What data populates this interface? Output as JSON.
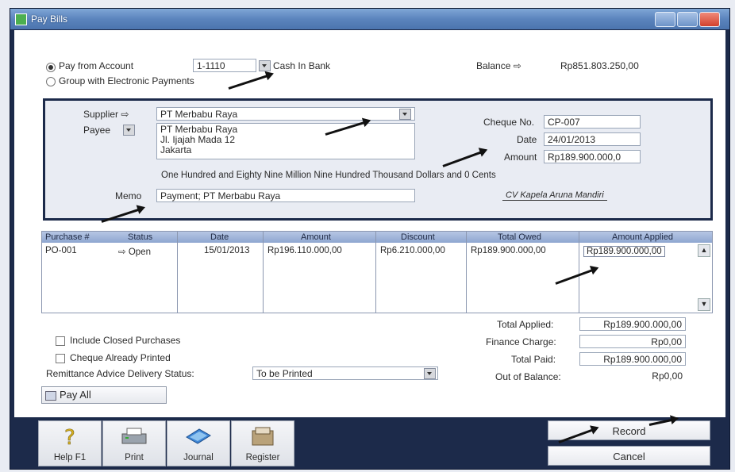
{
  "window": {
    "title": "Pay Bills"
  },
  "pay_from": {
    "label": "Pay from Account",
    "account_no": "1-1110",
    "account_name": "Cash In Bank",
    "group_label": "Group with Electronic Payments",
    "balance_label": "Balance ⇨",
    "balance_value": "Rp851.803.250,00"
  },
  "supplier": {
    "supplier_label": "Supplier ⇨",
    "supplier_value": "PT Merbabu Raya",
    "payee_label": "Payee",
    "payee_lines": [
      "PT Merbabu Raya",
      "Jl. Ijajah Mada 12",
      "Jakarta"
    ],
    "amount_words": "One Hundred and Eighty Nine Million Nine Hundred Thousand Dollars and 0 Cents",
    "memo_label": "Memo",
    "memo_value": "Payment; PT Merbabu Raya",
    "cheque_label": "Cheque No.",
    "cheque_value": "CP-007",
    "date_label": "Date",
    "date_value": "24/01/2013",
    "amount_label": "Amount",
    "amount_value": "Rp189.900.000,0",
    "signature": "CV Kapela Aruna Mandiri"
  },
  "grid": {
    "headers": [
      "Purchase #",
      "Status",
      "Date",
      "Amount",
      "Discount",
      "Total Owed",
      "Amount Applied"
    ],
    "rows": [
      {
        "purchase": "PO-001",
        "status": "⇨ Open",
        "date": "15/01/2013",
        "amount": "Rp196.110.000,00",
        "discount": "Rp6.210.000,00",
        "total_owed": "Rp189.900.000,00",
        "applied": "Rp189.900.000,00"
      }
    ]
  },
  "options": {
    "include_closed": "Include Closed Purchases",
    "cheque_printed": "Cheque Already Printed",
    "remittance_label": "Remittance Advice Delivery Status:",
    "remittance_value": "To be Printed",
    "pay_all": "Pay All"
  },
  "totals": {
    "total_applied_label": "Total Applied:",
    "total_applied": "Rp189.900.000,00",
    "finance_label": "Finance Charge:",
    "finance": "Rp0,00",
    "total_paid_label": "Total Paid:",
    "total_paid": "Rp189.900.000,00",
    "out_label": "Out of Balance:",
    "out": "Rp0,00"
  },
  "toolbar": {
    "help": "Help F1",
    "print": "Print",
    "journal": "Journal",
    "register": "Register",
    "record": "Record",
    "cancel": "Cancel"
  }
}
